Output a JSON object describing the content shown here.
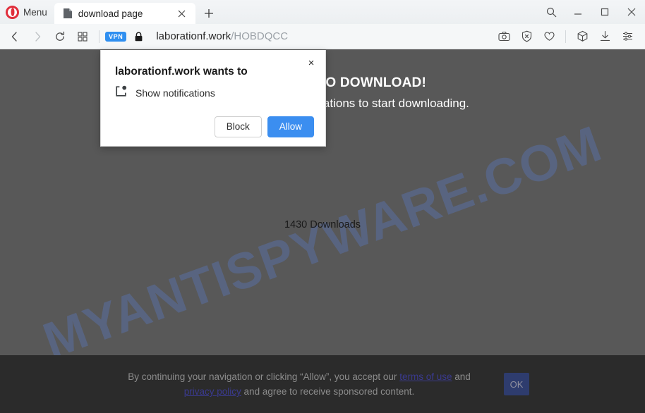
{
  "browser": {
    "menu_label": "Menu",
    "tab": {
      "title": "download page",
      "favicon": "page-icon",
      "close": "×"
    },
    "new_tab": "+",
    "window_controls": {
      "search": "search-icon",
      "minimize": "_",
      "maximize": "□",
      "close": "×"
    },
    "nav": {
      "back": "◁",
      "forward": "▷",
      "reload": "⟳",
      "grid": "grid-icon",
      "vpn_badge": "VPN",
      "lock": "lock-icon",
      "url_host": "laborationf.work",
      "url_path": "/HOBDQCC",
      "right_icons": [
        "camera-icon",
        "shield-block-icon",
        "heart-icon",
        "cube-icon",
        "download-icon",
        "sliders-icon"
      ]
    }
  },
  "permission_dialog": {
    "title": "laborationf.work wants to",
    "permission_label": "Show notifications",
    "permission_icon": "notification-icon",
    "close_label": "×",
    "block_label": "Block",
    "allow_label": "Allow"
  },
  "page": {
    "watermark": "MYANTISPYWARE.COM",
    "heading": "CLICK ALLOW TO DOWNLOAD!",
    "subtext": "Click Allow to receive notifications to start downloading.",
    "downloads_count": "1430 Downloads"
  },
  "banner": {
    "line1_pre": "By continuing your navigation or clicking “Allow”, you accept our ",
    "terms_link": "terms of use",
    "line2_pre": " and ",
    "privacy_link": "privacy policy",
    "line2_post": " and agree to receive sponsored content.",
    "ok_label": "OK"
  },
  "colors": {
    "page_bg": "#585858",
    "banner_bg": "#2b2b2b",
    "allow_blue": "#3b8ef0",
    "vpn_blue": "#2f8ff0",
    "opera_red": "#e02f3c",
    "ok_btn": "#2e3c6e",
    "watermark": "#5a78be"
  }
}
